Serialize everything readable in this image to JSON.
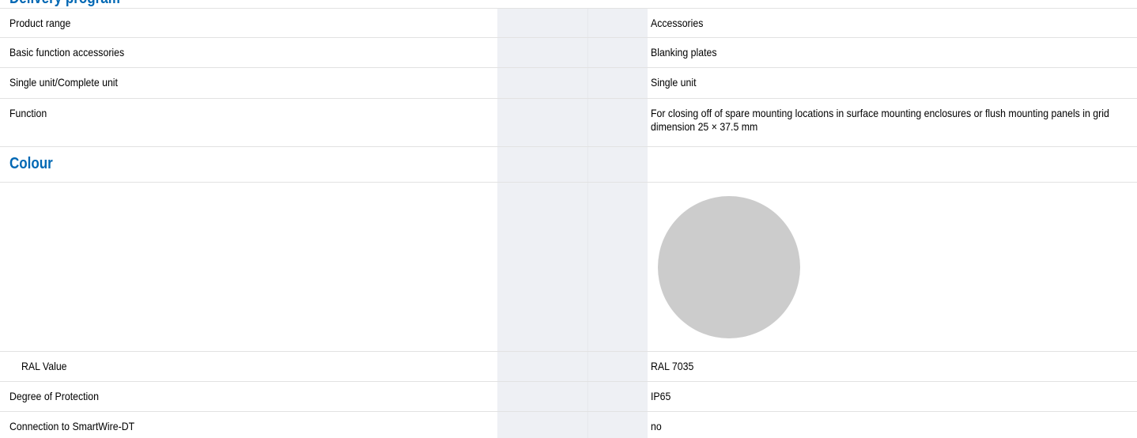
{
  "top_heading": "Delivery program",
  "rows": [
    {
      "label": "Product range",
      "value": "Accessories"
    },
    {
      "label": "Basic function accessories",
      "value": "Blanking plates"
    },
    {
      "label": "Single unit/Complete unit",
      "value": "Single unit"
    },
    {
      "label": "Function",
      "value": "For closing off of spare mounting locations in surface mounting enclosures or flush mounting panels in grid dimension 25 × 37.5 mm"
    }
  ],
  "colour_section": {
    "title": "Colour",
    "swatch_color": "#cccccc",
    "ral_label": "RAL Value",
    "ral_value": "RAL 7035"
  },
  "rows_after": [
    {
      "label": "Degree of Protection",
      "value": "IP65"
    },
    {
      "label": "Connection to SmartWire-DT",
      "value": "no"
    }
  ],
  "colors": {
    "heading_blue": "#0068b4",
    "column_shade": "#eef0f4",
    "row_border": "#e2e2e2"
  }
}
